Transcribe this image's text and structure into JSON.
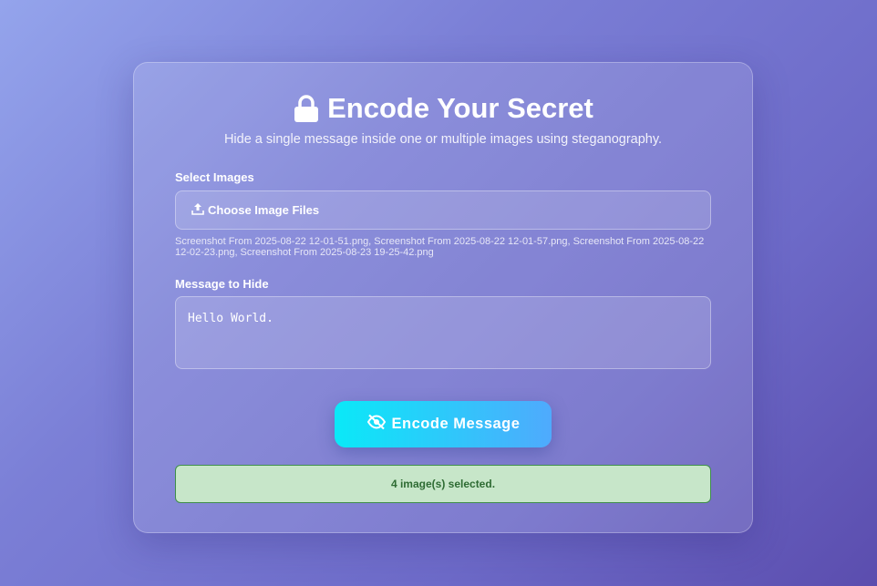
{
  "header": {
    "title": "Encode Your Secret",
    "subtitle": "Hide a single message inside one or multiple images using steganography.",
    "icon": "lock-icon"
  },
  "images": {
    "label": "Select Images",
    "button_label": "Choose Image Files",
    "button_icon": "upload-icon",
    "selected_files": "Screenshot From 2025-08-22 12-01-51.png, Screenshot From 2025-08-22 12-01-57.png, Screenshot From 2025-08-22 12-02-23.png, Screenshot From 2025-08-23 19-25-42.png"
  },
  "message": {
    "label": "Message to Hide",
    "value": "Hello World."
  },
  "encode_button": {
    "label": "Encode Message",
    "icon": "eye-slash-icon"
  },
  "status": {
    "text": "4 image(s) selected.",
    "color": "#2e6b33",
    "background": "#c7e6c9"
  }
}
